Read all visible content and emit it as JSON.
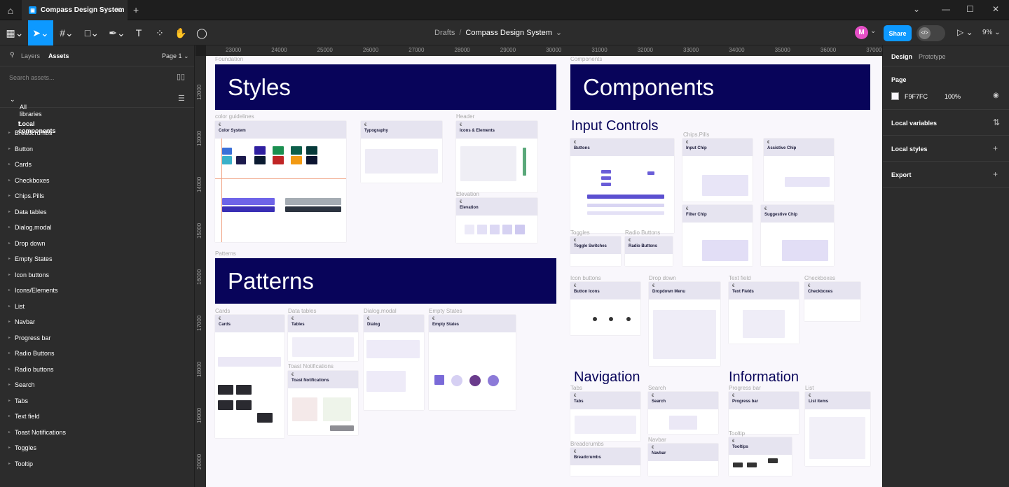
{
  "titlebar": {
    "tab_title": "Compass Design System",
    "tab_icon": "file-icon"
  },
  "toolbar": {
    "breadcrumb_drafts": "Drafts",
    "breadcrumb_sep": "/",
    "breadcrumb_file": "Compass Design System",
    "avatar_initial": "M",
    "share_label": "Share",
    "zoom": "9%"
  },
  "left_panel": {
    "tab_layers": "Layers",
    "tab_assets": "Assets",
    "page_selector": "Page 1",
    "search_placeholder": "Search assets...",
    "libraries": "All libraries",
    "local_components_title": "Local components",
    "components": [
      "Breadcrumbs",
      "Button",
      "Cards",
      "Checkboxes",
      "Chips.Pills",
      "Data tables",
      "Dialog.modal",
      "Drop down",
      "Empty States",
      "Icon buttons",
      "Icons/Elements",
      "List",
      "Navbar",
      "Progress bar",
      "Radio Buttons",
      "Radio buttons",
      "Search",
      "Tabs",
      "Text field",
      "Toast Notifications",
      "Toggles",
      "Tooltip"
    ]
  },
  "right_panel": {
    "tab_design": "Design",
    "tab_prototype": "Prototype",
    "page_title": "Page",
    "page_color": "F9F7FC",
    "page_opacity": "100%",
    "local_variables": "Local variables",
    "local_styles": "Local styles",
    "export": "Export"
  },
  "rulers": {
    "x": [
      "23000",
      "24000",
      "25000",
      "26000",
      "27000",
      "28000",
      "29000",
      "30000",
      "31000",
      "32000",
      "33000",
      "34000",
      "35000",
      "36000",
      "37000"
    ],
    "y": [
      "12000",
      "13000",
      "14000",
      "15000",
      "16000",
      "17000",
      "18000",
      "19000",
      "20000"
    ]
  },
  "canvas": {
    "frame_foundation": "Foundation",
    "frame_components": "Components",
    "banner_styles": "Styles",
    "banner_components": "Components",
    "banner_patterns": "Patterns",
    "frame_patterns": "Patterns",
    "heading_input_controls": "Input Controls",
    "heading_navigation": "Navigation",
    "heading_information": "Information",
    "frame_labels": {
      "color_guidelines": "color guidelines",
      "header": "Header",
      "elevation": "Elevation",
      "chips_pills": "Chips.Pills",
      "toggles": "Toggles",
      "radio_buttons": "Radio Buttons",
      "icon_buttons": "Icon buttons",
      "drop_down": "Drop down",
      "text_field": "Text field",
      "checkboxes": "Checkboxes",
      "cards": "Cards",
      "data_tables": "Data tables",
      "dialog_modal": "Dialog.modal",
      "empty_states": "Empty States",
      "toast_notifications": "Toast Notifications",
      "tabs": "Tabs",
      "search": "Search",
      "breadcrumbs": "Breadcrumbs",
      "navbar": "Navbar",
      "progress_bar": "Progress bar",
      "list": "List",
      "tooltip": "Tooltip"
    },
    "cards": {
      "color_system": "Color System",
      "typography": "Typography",
      "icons_elements": "Icons & Elements",
      "elevation": "Elevation",
      "buttons": "Buttons",
      "input_chip": "Input Chip",
      "assistive_chip": "Assistive Chip",
      "filter_chip": "Filter Chip",
      "suggestive_chip": "Suggestive Chip",
      "toggle_switches": "Toggle Switches",
      "radio_buttons": "Radio Buttons",
      "button_icons": "Button Icons",
      "dropdown_menu": "Dropdown Menu",
      "text_fields": "Text Fields",
      "checkboxes": "Checkboxes",
      "cards": "Cards",
      "tables": "Tables",
      "dialog": "Dialog",
      "empty_states": "Empty States",
      "toast_notifications": "Toast Notifications",
      "tabs": "Tabs",
      "search": "Search",
      "breadcrumbs": "Breadcrumbs",
      "navbar": "Navbar",
      "progress_bar": "Progress bar",
      "list_items": "List items",
      "tooltips": "Tooltips"
    },
    "card_mark": "€"
  },
  "colors": {
    "accent": "#0d99ff",
    "banner": "#08045a",
    "canvas_page": "#f9f7fc"
  }
}
